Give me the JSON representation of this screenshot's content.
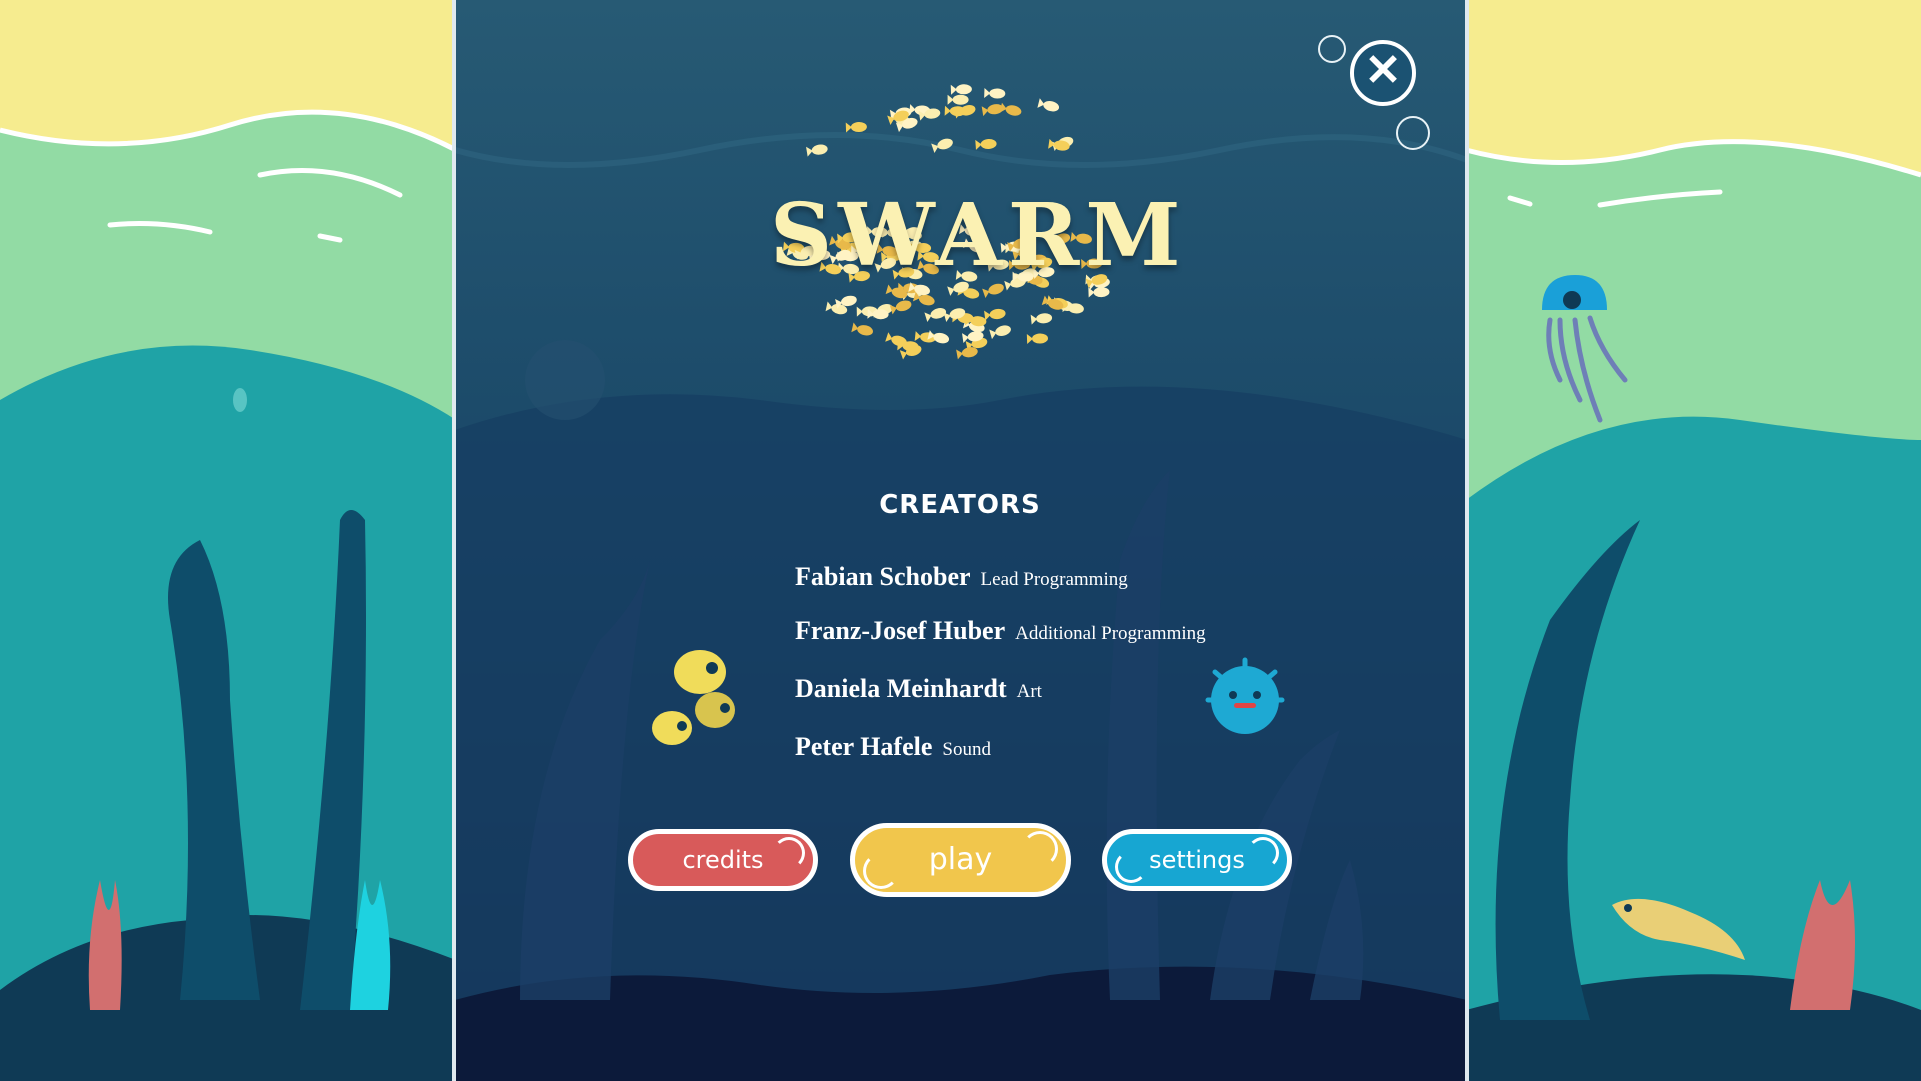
{
  "game": {
    "title": "SWARM",
    "close_symbol": "✕"
  },
  "creators": {
    "heading": "CREATORS",
    "people": [
      {
        "name": "Fabian Schober",
        "role": "Lead Programming"
      },
      {
        "name": "Franz-Josef Huber",
        "role": "Additional Programming"
      },
      {
        "name": "Daniela Meinhardt",
        "role": "Art"
      },
      {
        "name": "Peter Hafele",
        "role": "Sound"
      }
    ]
  },
  "buttons": {
    "credits": "credits",
    "play": "play",
    "settings": "settings"
  },
  "colors": {
    "sand": "#f6ec8f",
    "water_light": "#92dba4",
    "water_mid": "#1fa3a6",
    "panel_top": "#275a74",
    "panel_bottom": "#0f2044",
    "title_cream": "#fbf1b3",
    "credits_button": "#d85a5a",
    "play_button": "#f1c64c",
    "settings_button": "#17a6d2"
  },
  "icons": [
    "close-icon",
    "jellyfish-icon",
    "eel-icon",
    "butterflyfish-icon",
    "pufferfish-icon",
    "fish-school-icon"
  ]
}
